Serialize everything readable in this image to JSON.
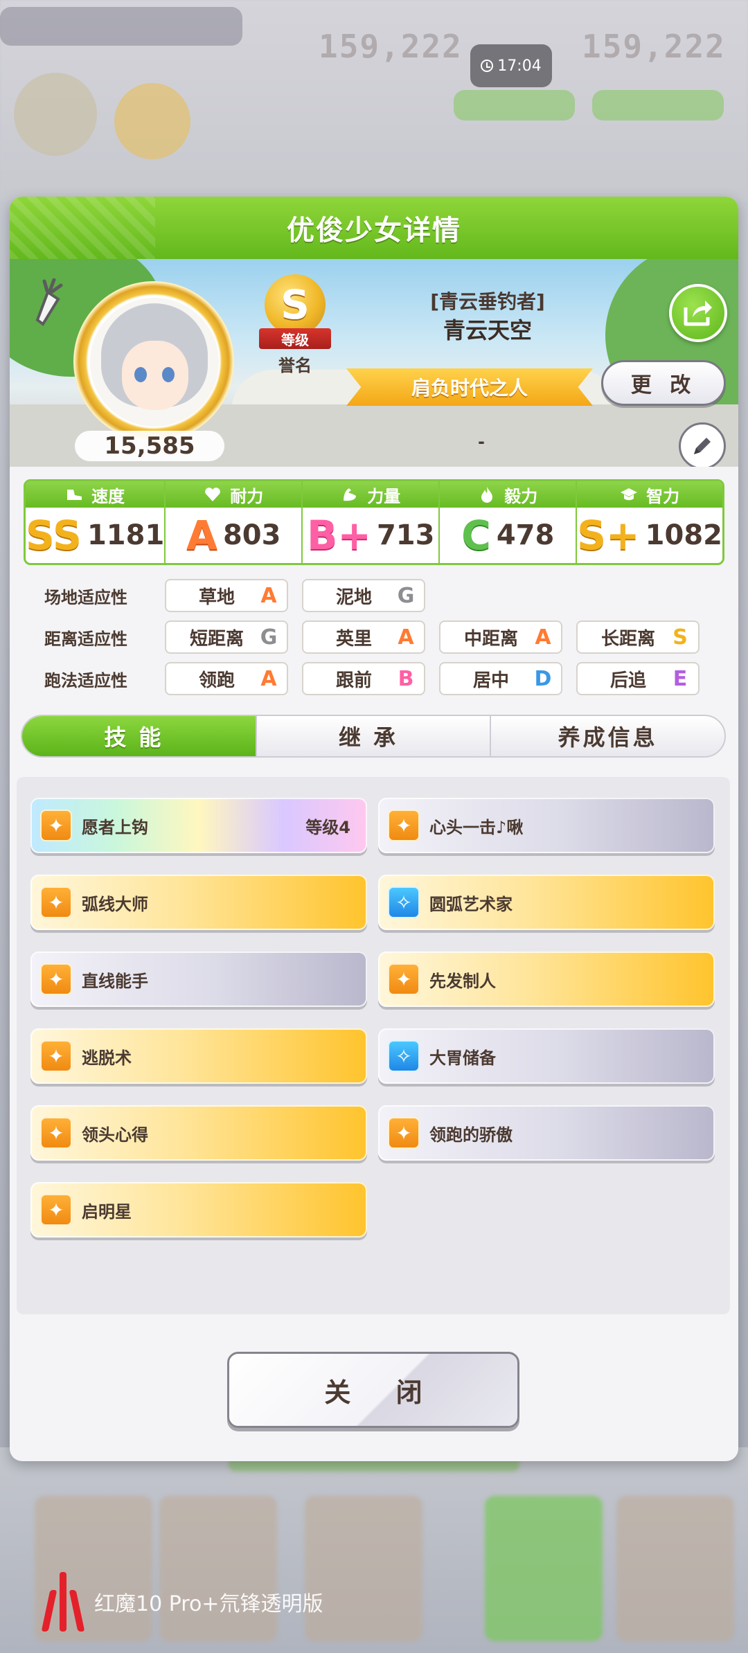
{
  "status": {
    "time": "17:04"
  },
  "panel": {
    "title": "优俊少女详情",
    "fan_count": "15,585",
    "rank": {
      "letter": "S",
      "ribbon": "等级",
      "honor": "誉名"
    },
    "trainer_title": "[青云垂钓者]",
    "trainer_name": "青云天空",
    "epithet": "肩负时代之人",
    "change_label": "更 改",
    "hero_dash": "-"
  },
  "stats": [
    {
      "label": "速度",
      "icon": "shoe-icon",
      "grade": "SS",
      "value": "1181",
      "color": "#f3b21c"
    },
    {
      "label": "耐力",
      "icon": "heart-icon",
      "grade": "A",
      "value": "803",
      "color": "#ff7b33"
    },
    {
      "label": "力量",
      "icon": "muscle-icon",
      "grade": "B+",
      "value": "713",
      "color": "#ff5fa4"
    },
    {
      "label": "毅力",
      "icon": "flame-icon",
      "grade": "C",
      "value": "478",
      "color": "#5fc04e"
    },
    {
      "label": "智力",
      "icon": "graduation-cap-icon",
      "grade": "S+",
      "value": "1082",
      "color": "#f3b21c"
    }
  ],
  "aptitude": {
    "track": {
      "label": "场地适应性",
      "items": [
        {
          "name": "草地",
          "grade": "A"
        },
        {
          "name": "泥地",
          "grade": "G"
        }
      ]
    },
    "distance": {
      "label": "距离适应性",
      "items": [
        {
          "name": "短距离",
          "grade": "G"
        },
        {
          "name": "英里",
          "grade": "A"
        },
        {
          "name": "中距离",
          "grade": "A"
        },
        {
          "name": "长距离",
          "grade": "S"
        }
      ]
    },
    "style": {
      "label": "跑法适应性",
      "items": [
        {
          "name": "领跑",
          "grade": "A"
        },
        {
          "name": "跟前",
          "grade": "B"
        },
        {
          "name": "居中",
          "grade": "D"
        },
        {
          "name": "后追",
          "grade": "E"
        }
      ]
    }
  },
  "tabs": [
    {
      "label": "技能"
    },
    {
      "label": "继承"
    },
    {
      "label": "养成信息"
    }
  ],
  "skills": [
    {
      "name": "愿者上钩",
      "level": "等级4",
      "style": "rainbow",
      "icon": "speed"
    },
    {
      "name": "心头一击♪啾",
      "style": "normal",
      "icon": "speed"
    },
    {
      "name": "弧线大师",
      "style": "gold",
      "icon": "speed"
    },
    {
      "name": "圆弧艺术家",
      "style": "gold",
      "icon": "recovery"
    },
    {
      "name": "直线能手",
      "style": "normal",
      "icon": "speed"
    },
    {
      "name": "先发制人",
      "style": "gold",
      "icon": "speed"
    },
    {
      "name": "逃脱术",
      "style": "gold",
      "icon": "speed"
    },
    {
      "name": "大胃储备",
      "style": "normal",
      "icon": "recovery"
    },
    {
      "name": "领头心得",
      "style": "gold",
      "icon": "speed"
    },
    {
      "name": "领跑的骄傲",
      "style": "normal",
      "icon": "speed"
    },
    {
      "name": "启明星",
      "style": "gold",
      "icon": "speed"
    }
  ],
  "close_label": "关 闭",
  "background": {
    "num_left": "159,222",
    "num_right": "159,222"
  },
  "watermark": "红魔10 Pro+氘锋透明版"
}
